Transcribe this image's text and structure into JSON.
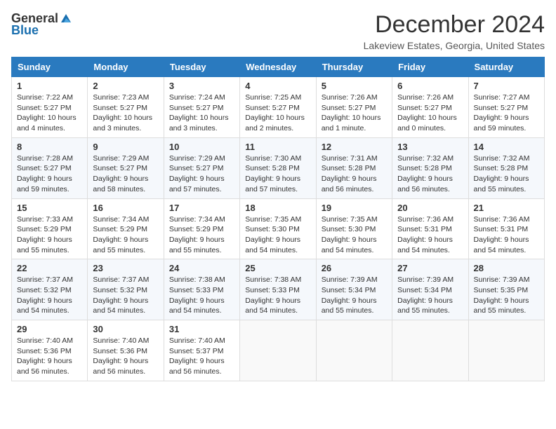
{
  "logo": {
    "general": "General",
    "blue": "Blue"
  },
  "title": "December 2024",
  "location": "Lakeview Estates, Georgia, United States",
  "weekdays": [
    "Sunday",
    "Monday",
    "Tuesday",
    "Wednesday",
    "Thursday",
    "Friday",
    "Saturday"
  ],
  "weeks": [
    [
      {
        "day": "1",
        "sunrise": "7:22 AM",
        "sunset": "5:27 PM",
        "daylight": "10 hours and 4 minutes."
      },
      {
        "day": "2",
        "sunrise": "7:23 AM",
        "sunset": "5:27 PM",
        "daylight": "10 hours and 3 minutes."
      },
      {
        "day": "3",
        "sunrise": "7:24 AM",
        "sunset": "5:27 PM",
        "daylight": "10 hours and 3 minutes."
      },
      {
        "day": "4",
        "sunrise": "7:25 AM",
        "sunset": "5:27 PM",
        "daylight": "10 hours and 2 minutes."
      },
      {
        "day": "5",
        "sunrise": "7:26 AM",
        "sunset": "5:27 PM",
        "daylight": "10 hours and 1 minute."
      },
      {
        "day": "6",
        "sunrise": "7:26 AM",
        "sunset": "5:27 PM",
        "daylight": "10 hours and 0 minutes."
      },
      {
        "day": "7",
        "sunrise": "7:27 AM",
        "sunset": "5:27 PM",
        "daylight": "9 hours and 59 minutes."
      }
    ],
    [
      {
        "day": "8",
        "sunrise": "7:28 AM",
        "sunset": "5:27 PM",
        "daylight": "9 hours and 59 minutes."
      },
      {
        "day": "9",
        "sunrise": "7:29 AM",
        "sunset": "5:27 PM",
        "daylight": "9 hours and 58 minutes."
      },
      {
        "day": "10",
        "sunrise": "7:29 AM",
        "sunset": "5:27 PM",
        "daylight": "9 hours and 57 minutes."
      },
      {
        "day": "11",
        "sunrise": "7:30 AM",
        "sunset": "5:28 PM",
        "daylight": "9 hours and 57 minutes."
      },
      {
        "day": "12",
        "sunrise": "7:31 AM",
        "sunset": "5:28 PM",
        "daylight": "9 hours and 56 minutes."
      },
      {
        "day": "13",
        "sunrise": "7:32 AM",
        "sunset": "5:28 PM",
        "daylight": "9 hours and 56 minutes."
      },
      {
        "day": "14",
        "sunrise": "7:32 AM",
        "sunset": "5:28 PM",
        "daylight": "9 hours and 55 minutes."
      }
    ],
    [
      {
        "day": "15",
        "sunrise": "7:33 AM",
        "sunset": "5:29 PM",
        "daylight": "9 hours and 55 minutes."
      },
      {
        "day": "16",
        "sunrise": "7:34 AM",
        "sunset": "5:29 PM",
        "daylight": "9 hours and 55 minutes."
      },
      {
        "day": "17",
        "sunrise": "7:34 AM",
        "sunset": "5:29 PM",
        "daylight": "9 hours and 55 minutes."
      },
      {
        "day": "18",
        "sunrise": "7:35 AM",
        "sunset": "5:30 PM",
        "daylight": "9 hours and 54 minutes."
      },
      {
        "day": "19",
        "sunrise": "7:35 AM",
        "sunset": "5:30 PM",
        "daylight": "9 hours and 54 minutes."
      },
      {
        "day": "20",
        "sunrise": "7:36 AM",
        "sunset": "5:31 PM",
        "daylight": "9 hours and 54 minutes."
      },
      {
        "day": "21",
        "sunrise": "7:36 AM",
        "sunset": "5:31 PM",
        "daylight": "9 hours and 54 minutes."
      }
    ],
    [
      {
        "day": "22",
        "sunrise": "7:37 AM",
        "sunset": "5:32 PM",
        "daylight": "9 hours and 54 minutes."
      },
      {
        "day": "23",
        "sunrise": "7:37 AM",
        "sunset": "5:32 PM",
        "daylight": "9 hours and 54 minutes."
      },
      {
        "day": "24",
        "sunrise": "7:38 AM",
        "sunset": "5:33 PM",
        "daylight": "9 hours and 54 minutes."
      },
      {
        "day": "25",
        "sunrise": "7:38 AM",
        "sunset": "5:33 PM",
        "daylight": "9 hours and 54 minutes."
      },
      {
        "day": "26",
        "sunrise": "7:39 AM",
        "sunset": "5:34 PM",
        "daylight": "9 hours and 55 minutes."
      },
      {
        "day": "27",
        "sunrise": "7:39 AM",
        "sunset": "5:34 PM",
        "daylight": "9 hours and 55 minutes."
      },
      {
        "day": "28",
        "sunrise": "7:39 AM",
        "sunset": "5:35 PM",
        "daylight": "9 hours and 55 minutes."
      }
    ],
    [
      {
        "day": "29",
        "sunrise": "7:40 AM",
        "sunset": "5:36 PM",
        "daylight": "9 hours and 56 minutes."
      },
      {
        "day": "30",
        "sunrise": "7:40 AM",
        "sunset": "5:36 PM",
        "daylight": "9 hours and 56 minutes."
      },
      {
        "day": "31",
        "sunrise": "7:40 AM",
        "sunset": "5:37 PM",
        "daylight": "9 hours and 56 minutes."
      },
      null,
      null,
      null,
      null
    ]
  ]
}
